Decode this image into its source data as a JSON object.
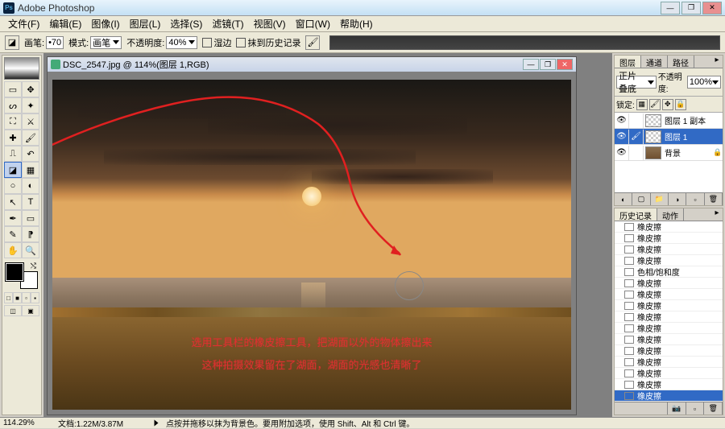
{
  "app": {
    "title": "Adobe Photoshop"
  },
  "win_controls": {
    "min": "—",
    "max": "❐",
    "close": "✕"
  },
  "menubar": [
    "文件(F)",
    "编辑(E)",
    "图像(I)",
    "图层(L)",
    "选择(S)",
    "滤镜(T)",
    "视图(V)",
    "窗口(W)",
    "帮助(H)"
  ],
  "options_bar": {
    "brush_label": "画笔:",
    "brush_size": "70",
    "mode_label": "模式:",
    "mode_value": "画笔",
    "opacity_label": "不透明度:",
    "opacity_value": "40%",
    "chk_wet": "湿边",
    "chk_history": "抹到历史记录"
  },
  "doc": {
    "title": "DSC_2547.jpg @ 114%(图层 1,RGB)"
  },
  "overlay": {
    "line1": "选用工具栏的橡皮擦工具，把湖面以外的物体擦出来",
    "line2": "这种拍摄效果留在了湖面，湖面的光感也清晰了"
  },
  "panels": {
    "layers": {
      "tabs": [
        "图层",
        "通道",
        "路径"
      ],
      "blend_value": "正片叠底",
      "opacity_label": "不透明度:",
      "opacity_value": "100%",
      "lock_label": "锁定:",
      "items": [
        {
          "name": "图层 1 副本",
          "vis": "👁",
          "link": "",
          "active": false,
          "thumb": "checker",
          "lock": ""
        },
        {
          "name": "图层 1",
          "vis": "👁",
          "link": "🖌",
          "active": true,
          "thumb": "checker",
          "lock": ""
        },
        {
          "name": "背景",
          "vis": "👁",
          "link": "",
          "active": false,
          "thumb": "img",
          "lock": "🔒"
        }
      ]
    },
    "history": {
      "tabs": [
        "历史记录",
        "动作"
      ],
      "items": [
        {
          "name": "橡皮擦",
          "kind": "step"
        },
        {
          "name": "橡皮擦",
          "kind": "step"
        },
        {
          "name": "橡皮擦",
          "kind": "step"
        },
        {
          "name": "橡皮擦",
          "kind": "step"
        },
        {
          "name": "色相/饱和度",
          "kind": "step"
        },
        {
          "name": "橡皮擦",
          "kind": "step"
        },
        {
          "name": "橡皮擦",
          "kind": "step"
        },
        {
          "name": "橡皮擦",
          "kind": "step"
        },
        {
          "name": "橡皮擦",
          "kind": "step"
        },
        {
          "name": "橡皮擦",
          "kind": "step"
        },
        {
          "name": "橡皮擦",
          "kind": "step"
        },
        {
          "name": "橡皮擦",
          "kind": "step"
        },
        {
          "name": "橡皮擦",
          "kind": "step"
        },
        {
          "name": "橡皮擦",
          "kind": "step"
        },
        {
          "name": "橡皮擦",
          "kind": "step"
        },
        {
          "name": "橡皮擦",
          "kind": "active"
        }
      ]
    }
  },
  "statusbar": {
    "zoom": "114.29%",
    "doc": "文档:1.22M/3.87M",
    "hint": "点按并拖移以抹为背景色。要用附加选项，使用 Shift、Alt 和 Ctrl 键。"
  }
}
